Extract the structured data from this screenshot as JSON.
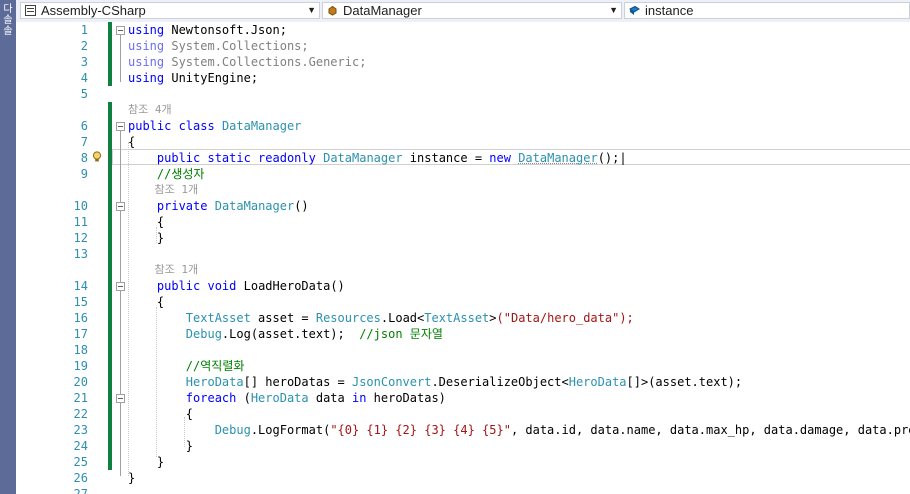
{
  "left_tab": {
    "label": "다 솔 솔"
  },
  "nav": {
    "project": "Assembly-CSharp",
    "type": "DataManager",
    "member": "instance"
  },
  "icons": {
    "project": "csharp-project-icon",
    "type": "class-icon",
    "member": "field-icon",
    "lightbulb": "lightbulb-icon"
  },
  "colors": {
    "keyword": "#0000ff",
    "type": "#2b91af",
    "string": "#a31515",
    "comment": "#008000",
    "line_number": "#2b91af",
    "change_bar": "#108040"
  },
  "editor": {
    "line_numbers": [
      "1",
      "2",
      "3",
      "4",
      "5",
      "6",
      "7",
      "8",
      "9",
      "10",
      "11",
      "12",
      "13",
      "14",
      "15",
      "16",
      "17",
      "18",
      "19",
      "20",
      "21",
      "22",
      "23",
      "24",
      "25",
      "26",
      "27"
    ],
    "code_lens": {
      "class_refs": "참조 4개",
      "ctor_refs": "참조 1개",
      "method_refs": "참조 1개"
    },
    "lines": {
      "l1": "Newtonsoft.Json;",
      "l2": "System.Collections;",
      "l3": "System.Collections.Generic;",
      "l4": "UnityEngine;",
      "l6_class": "DataManager",
      "l8_field": " instance = ",
      "l8_type": "DataManager",
      "l9_comment": "//생성자",
      "l10_name": "DataManager",
      "l14_name": "LoadHeroData",
      "l16_text": "(\"Data/hero_data\");",
      "l17_comment": "//json 문자열",
      "l19_comment": "//역직렬화",
      "l23_fmt": "\"{0} {1} {2} {3} {4} {5}\"",
      "l23_rest": ", data.id, data.name, data.max_hp, data.damage, data.prefab"
    }
  }
}
